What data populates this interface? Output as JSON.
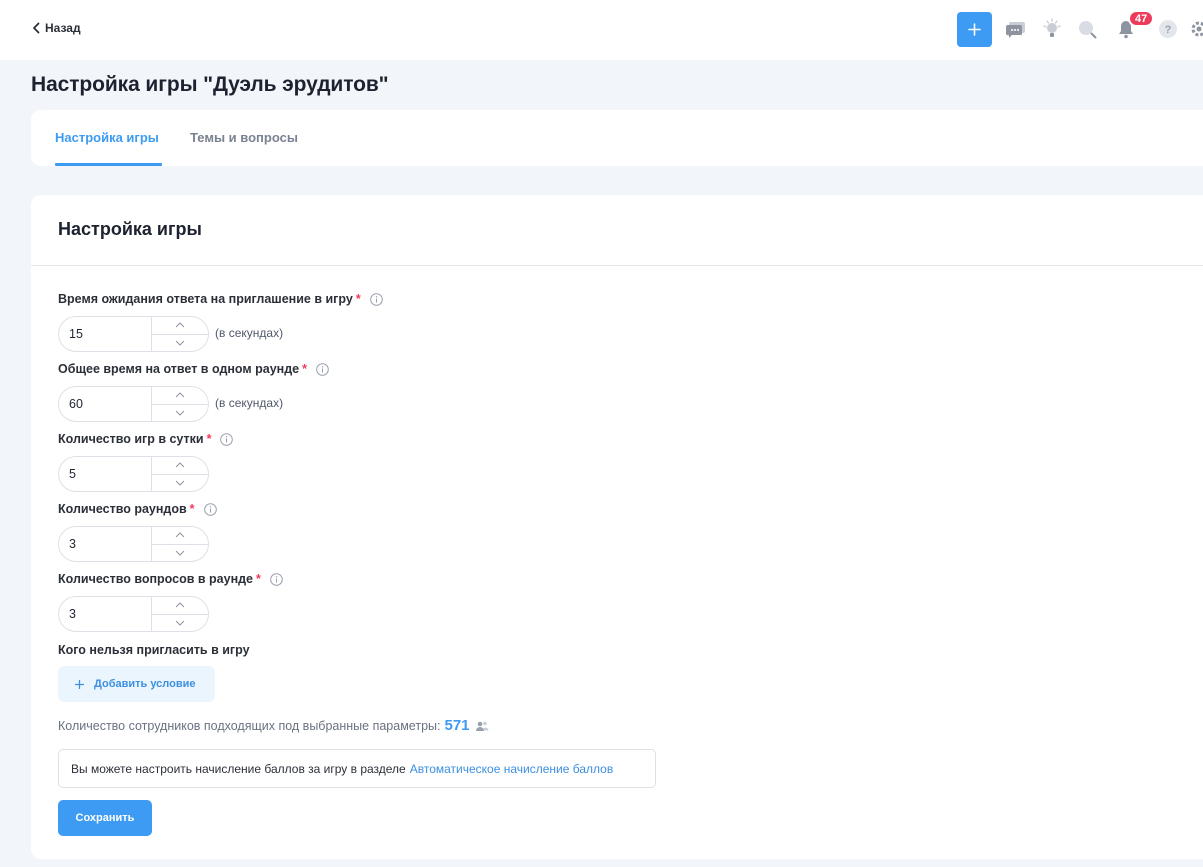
{
  "header": {
    "back_label": "Назад",
    "notifications_count": "47",
    "icons": [
      "plus-icon",
      "chat-icon",
      "lightbulb-icon",
      "search-icon",
      "bell-icon",
      "help-icon",
      "gear-icon"
    ]
  },
  "page_title": "Настройка игры \"Дуэль эрудитов\"",
  "tabs": [
    {
      "label": "Настройка игры",
      "active": true
    },
    {
      "label": "Темы и вопросы",
      "active": false
    }
  ],
  "card": {
    "title": "Настройка игры",
    "fields": [
      {
        "label": "Время ожидания ответа на приглашение в игру",
        "required": "*",
        "value": "15",
        "unit": "(в секундах)"
      },
      {
        "label": "Общее время на ответ в одном раунде",
        "required": "*",
        "value": "60",
        "unit": "(в секундах)"
      },
      {
        "label": "Количество игр в сутки",
        "required": "*",
        "value": "5",
        "unit": ""
      },
      {
        "label": "Количество раундов",
        "required": "*",
        "value": "3",
        "unit": ""
      },
      {
        "label": "Количество вопросов в раунде",
        "required": "*",
        "value": "3",
        "unit": ""
      }
    ],
    "exclusion_label": "Кого нельзя пригласить в игру",
    "add_condition_label": "Добавить условие",
    "count_label": "Количество сотрудников подходящих под выбранные параметры:",
    "count_value": "571",
    "notice_text": "Вы можете настроить начисление баллов за игру в разделе",
    "notice_link": "Автоматическое начисление баллов",
    "save_label": "Сохранить"
  },
  "colors": {
    "accent": "#3d9bf3",
    "badge": "#ef3b5b",
    "background": "#f2f5f9"
  }
}
